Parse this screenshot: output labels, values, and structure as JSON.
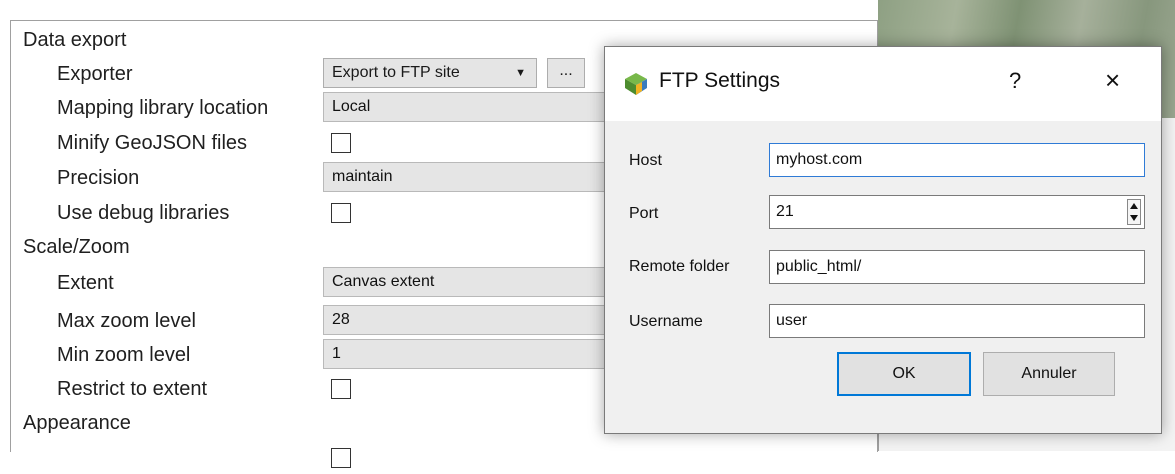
{
  "settings": {
    "data_export": "Data export",
    "exporter_label": "Exporter",
    "exporter_value": "Export to FTP site",
    "more_label": "...",
    "mapping_library_label": "Mapping library location",
    "mapping_library_value": "Local",
    "minify_label": "Minify GeoJSON files",
    "precision_label": "Precision",
    "precision_value": "maintain",
    "debug_label": "Use debug libraries",
    "scale_zoom": "Scale/Zoom",
    "extent_label": "Extent",
    "extent_value": "Canvas extent",
    "max_zoom_label": "Max zoom level",
    "max_zoom_value": "28",
    "min_zoom_label": "Min zoom level",
    "min_zoom_value": "1",
    "restrict_label": "Restrict to extent",
    "appearance": "Appearance"
  },
  "dialog": {
    "title": "FTP Settings",
    "help": "?",
    "close": "×",
    "host_label": "Host",
    "host_value": "myhost.com",
    "port_label": "Port",
    "port_value": "21",
    "folder_label": "Remote folder",
    "folder_value": "public_html/",
    "username_label": "Username",
    "username_value": "user",
    "ok": "OK",
    "cancel": "Annuler"
  },
  "colors": {
    "accent": "#0078d7",
    "focus": "#2f7bd6",
    "field_bg": "#e5e5e5"
  },
  "icons": {
    "app": "qgis-logo-icon",
    "combo_arrow": "chevron-down-icon",
    "spin": "spin-arrows-icon"
  }
}
